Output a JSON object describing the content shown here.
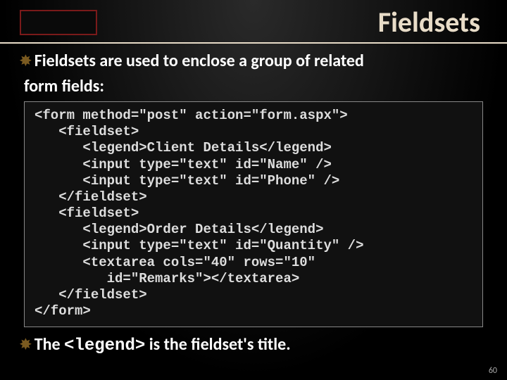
{
  "title": "Fieldsets",
  "bullets": {
    "line1a": "Fieldsets are used to enclose a group of related",
    "line1b": "form fields:",
    "line2a": "The ",
    "line2b": "<legend>",
    "line2c": " is the fieldset's title."
  },
  "code": "<form method=\"post\" action=\"form.aspx\">\n   <fieldset>\n      <legend>Client Details</legend>\n      <input type=\"text\" id=\"Name\" />\n      <input type=\"text\" id=\"Phone\" />\n   </fieldset>\n   <fieldset>\n      <legend>Order Details</legend>\n      <input type=\"text\" id=\"Quantity\" />\n      <textarea cols=\"40\" rows=\"10\"\n         id=\"Remarks\"></textarea>\n   </fieldset>\n</form>",
  "page_number": "60"
}
